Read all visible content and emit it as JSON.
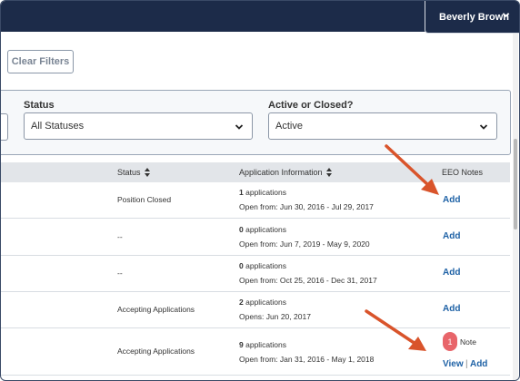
{
  "header": {
    "user_name": "Beverly Brown",
    "user_menu_icon": "chevron-down-icon"
  },
  "toolbar": {
    "clear_filters_label": "Clear Filters"
  },
  "filters": {
    "status": {
      "label": "Status",
      "value": "All Statuses"
    },
    "active_closed": {
      "label": "Active or Closed?",
      "value": "Active"
    }
  },
  "table": {
    "columns": [
      {
        "label": "Status",
        "sortable": true
      },
      {
        "label": "Application Information",
        "sortable": true
      },
      {
        "label": "EEO Notes",
        "sortable": false
      }
    ],
    "rows": [
      {
        "status": "Position Closed",
        "count": "1",
        "count_suffix": "applications",
        "dates": "Open from: Jun 30, 2016 - Jul 29, 2017",
        "eeo_add": "Add"
      },
      {
        "status": "--",
        "count": "0",
        "count_suffix": "applications",
        "dates": "Open from: Jun 7, 2019 - May 9, 2020",
        "eeo_add": "Add"
      },
      {
        "status": "--",
        "count": "0",
        "count_suffix": "applications",
        "dates": "Open from: Oct 25, 2016 - Dec 31, 2017",
        "eeo_add": "Add"
      },
      {
        "status": "Accepting Applications",
        "count": "2",
        "count_suffix": "applications",
        "dates": "Opens: Jun 20, 2017",
        "eeo_add": "Add"
      },
      {
        "status": "Accepting Applications",
        "count": "9",
        "count_suffix": "applications",
        "dates": "Open from: Jan 31, 2016 - May 1, 2018",
        "note_count": "1",
        "note_label": "Note",
        "eeo_view": "View",
        "separator": "|",
        "eeo_add": "Add"
      }
    ]
  },
  "annotation_color": "#d9542b"
}
